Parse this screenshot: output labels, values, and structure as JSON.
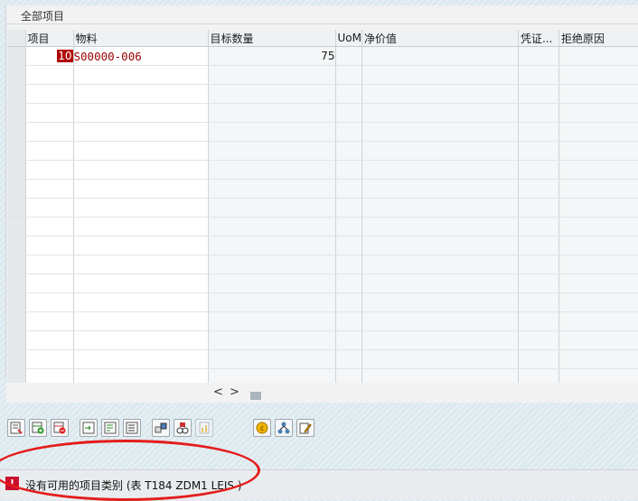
{
  "tab": {
    "title": "全部项目"
  },
  "table": {
    "columns": [
      "项目",
      "物料",
      "目标数量",
      "UoM",
      "净价值",
      "凭证...",
      "拒绝原因"
    ],
    "rows": [
      {
        "item": "10",
        "material": "S00000-006",
        "target_qty": "75",
        "uom": "",
        "net_value": "",
        "doc": "",
        "reason": ""
      }
    ],
    "empty_row_count": 17
  },
  "scroll": {
    "left_arrow": "<",
    "right_arrow": ">"
  },
  "toolbar": {
    "buttons": [
      "details-icon",
      "insert-row-icon",
      "delete-row-icon",
      "select-all-icon",
      "deselect-icon",
      "item-details-icon",
      "configuration-icon",
      "batch-icon",
      "pricing-icon",
      "coin-icon",
      "structure-icon",
      "edit-icon"
    ]
  },
  "status": {
    "type": "error",
    "icon": "!",
    "message": "没有可用的项目类别 (表 T184 ZDM1 LEIS  )"
  },
  "colors": {
    "error_red": "#c8102e",
    "highlight_ring": "#e41c1c",
    "material_text": "#9a0000"
  }
}
